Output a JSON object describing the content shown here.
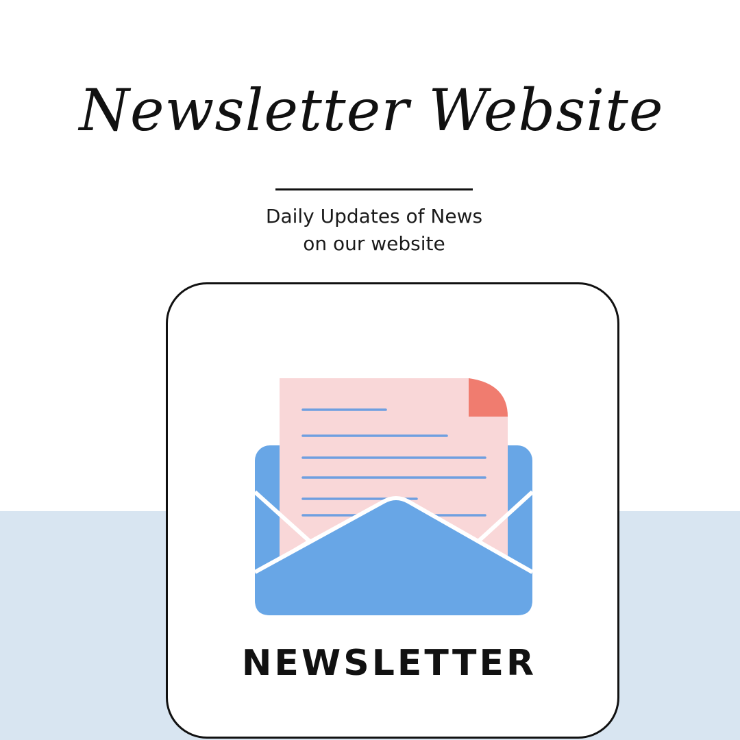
{
  "header": {
    "title": "Newsletter Website",
    "subtitle_line1": "Daily Updates of News",
    "subtitle_line2": "on our website"
  },
  "card": {
    "label": "NEWSLETTER",
    "icon": "open-envelope-with-letter-icon"
  },
  "colors": {
    "background": "#ffffff",
    "band": "#d8e5f1",
    "envelope": "#68a6e6",
    "paper": "#f9d7d8",
    "corner": "#f07c6f",
    "lines": "#6f9fe0",
    "text": "#111111"
  }
}
